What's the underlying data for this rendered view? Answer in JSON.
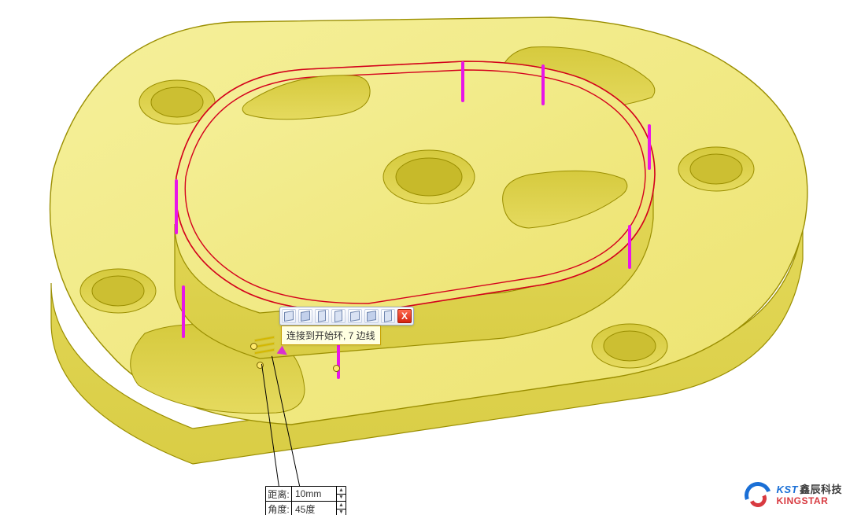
{
  "context_toolbar": {
    "buttons": [
      {
        "name": "ctx-chamfer-dist-dist",
        "icon": "mini-cube"
      },
      {
        "name": "ctx-chamfer-dist-angle",
        "icon": "mini-cube alt"
      },
      {
        "name": "ctx-chamfer-vertex-1",
        "icon": "mini-cube thin"
      },
      {
        "name": "ctx-chamfer-vertex-2",
        "icon": "mini-cube thin"
      },
      {
        "name": "ctx-chamfer-face",
        "icon": "mini-cube"
      },
      {
        "name": "ctx-chamfer-isoline",
        "icon": "mini-cube alt"
      },
      {
        "name": "ctx-chamfer-offset",
        "icon": "mini-cube thin"
      }
    ],
    "close_label": "X"
  },
  "tooltip_text": "连接到开始环, 7 边线",
  "param_panel": {
    "distance": {
      "label": "距离:",
      "value": "10mm"
    },
    "angle": {
      "label": "角度:",
      "value": "45度"
    }
  },
  "selection": {
    "edge_highlight_color": "#e815e8",
    "loop_outline_color": "#d4001c",
    "edge_count": 7
  },
  "watermark": {
    "kst": "KST",
    "cn": "鑫辰科技",
    "en": "KINGSTAR"
  },
  "colors": {
    "model_fill_light": "#f0ea82",
    "model_fill_dark": "#e8df63",
    "model_edge": "#9a8e00"
  }
}
